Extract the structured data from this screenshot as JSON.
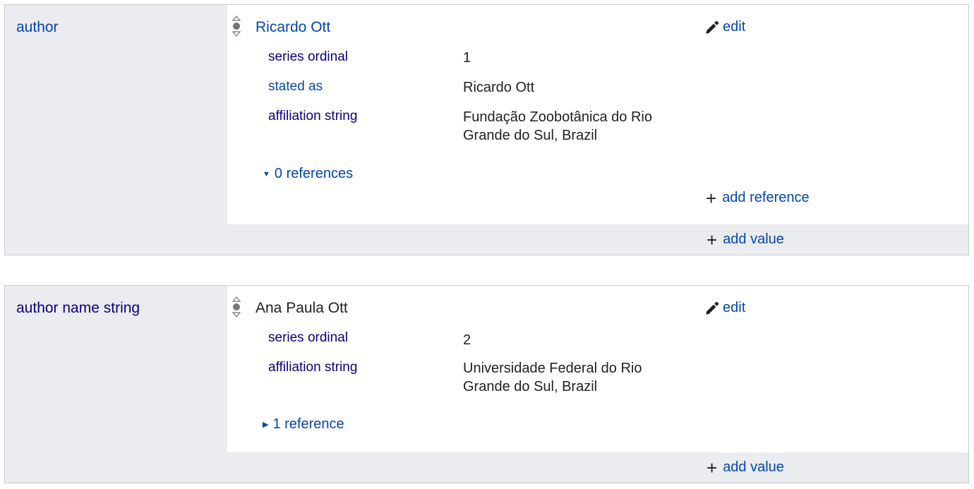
{
  "author_group": {
    "property": "author",
    "value": "Ricardo Ott",
    "edit_label": "edit",
    "qualifiers": [
      {
        "property": "series ordinal",
        "value": "1"
      },
      {
        "property": "stated as",
        "value": "Ricardo Ott"
      },
      {
        "property": "affiliation string",
        "value_line1": "Fundação Zoobotânica do Rio",
        "value_line2": "Grande do Sul, Brazil"
      }
    ],
    "references_label": "0 references",
    "add_reference_label": "add reference",
    "add_value_label": "add value"
  },
  "author_name_string_group": {
    "property": "author name string",
    "value": "Ana Paula Ott",
    "edit_label": "edit",
    "qualifiers": [
      {
        "property": "series ordinal",
        "value": "2"
      },
      {
        "property": "affiliation string",
        "value_line1": "Universidade Federal do Rio",
        "value_line2": "Grande do Sul, Brazil"
      }
    ],
    "references_label": "1 reference",
    "add_value_label": "add value"
  },
  "icons": {
    "rank": "rank-normal-icon",
    "edit": "pencil-icon",
    "add": "plus-icon",
    "expanded": "triangle-down-icon",
    "collapsed": "triangle-right-icon"
  }
}
